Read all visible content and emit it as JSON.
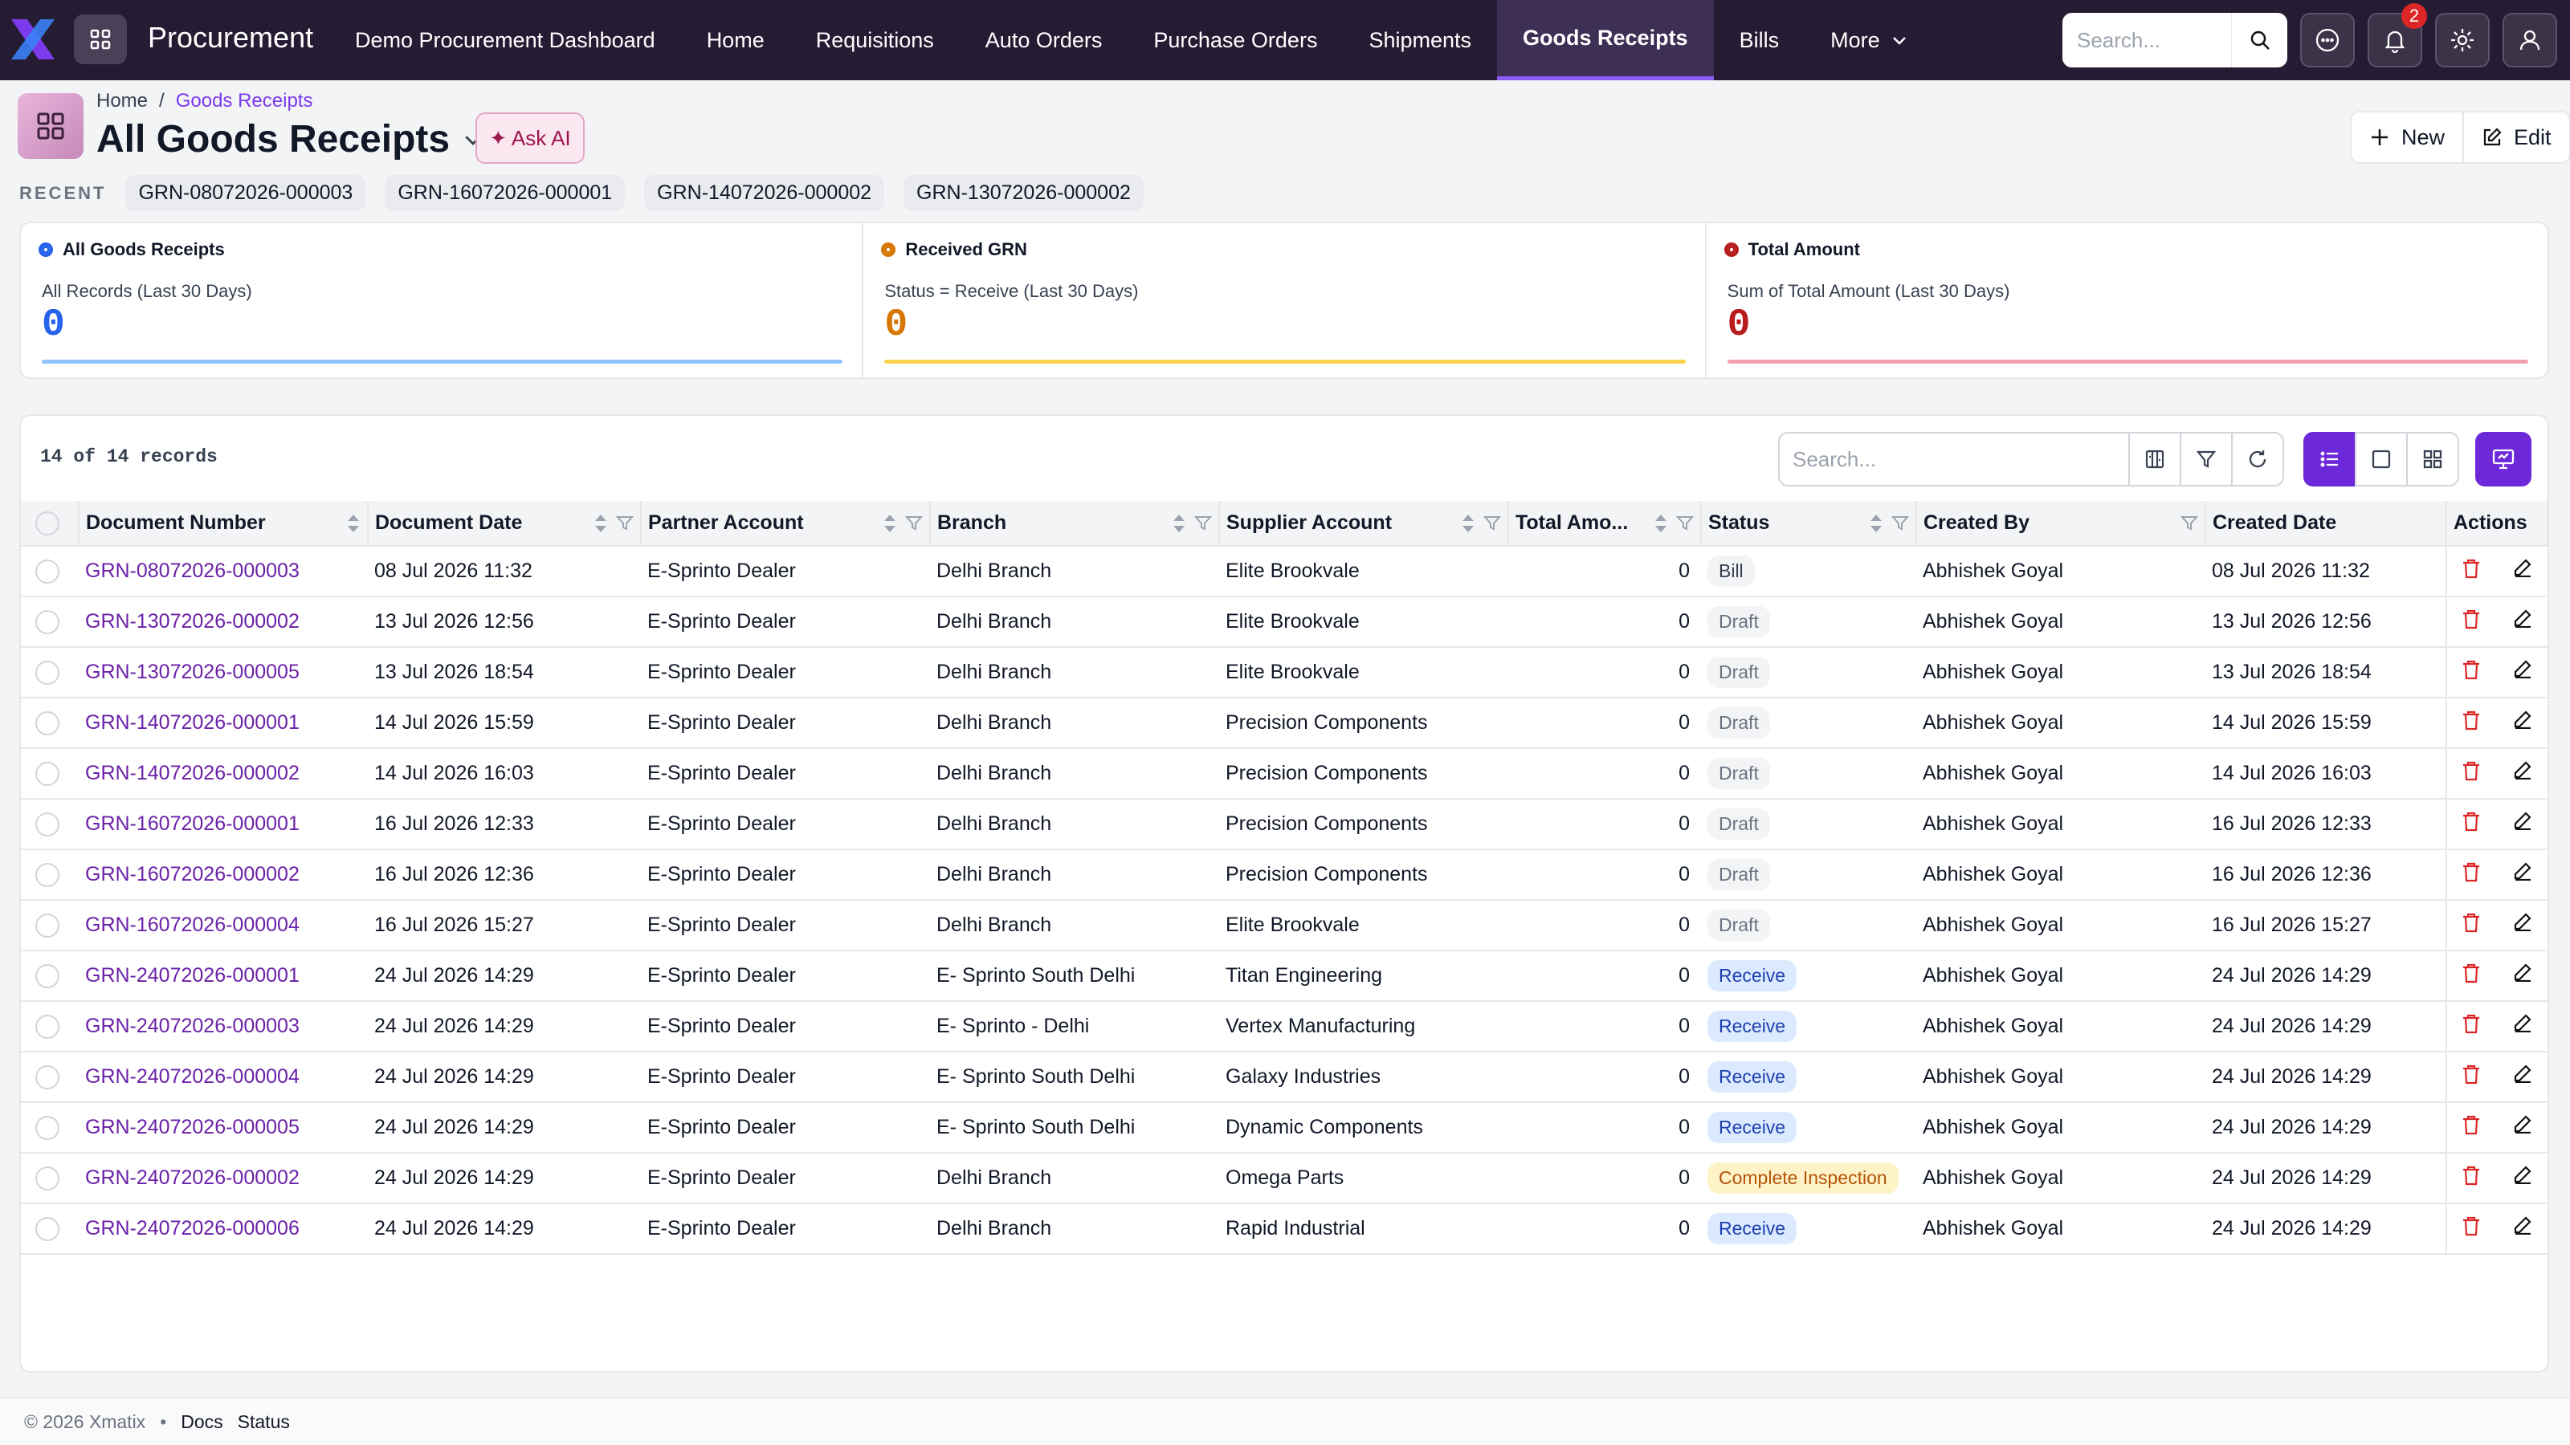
{
  "app": {
    "title": "Procurement"
  },
  "nav": {
    "items": [
      "Demo Procurement Dashboard",
      "Home",
      "Requisitions",
      "Auto Orders",
      "Purchase Orders",
      "Shipments",
      "Goods Receipts",
      "Bills"
    ],
    "more": "More",
    "active": "Goods Receipts"
  },
  "top": {
    "search_placeholder": "Search...",
    "notifications_count": "2"
  },
  "breadcrumb": {
    "home": "Home",
    "sep": "/",
    "current": "Goods Receipts"
  },
  "page": {
    "title": "All Goods Receipts",
    "ask_ai": "✦ Ask AI",
    "new_label": "New",
    "edit_label": "Edit"
  },
  "recent": {
    "label": "RECENT",
    "items": [
      "GRN-08072026-000003",
      "GRN-16072026-000001",
      "GRN-14072026-000002",
      "GRN-13072026-000002"
    ]
  },
  "stats": [
    {
      "title": "All Goods Receipts",
      "subtitle": "All Records (Last 30 Days)",
      "value": "0",
      "color": "#2563eb",
      "bar": "#93c5fd"
    },
    {
      "title": "Received GRN",
      "subtitle": "Status = Receive (Last 30 Days)",
      "value": "0",
      "color": "#d97706",
      "bar": "#fcd34d"
    },
    {
      "title": "Total Amount",
      "subtitle": "Sum of Total Amount (Last 30 Days)",
      "value": "0",
      "color": "#b91c1c",
      "bar": "#f0a3ad"
    }
  ],
  "table": {
    "records_label": "14 of 14 records",
    "search_placeholder": "Search...",
    "columns": [
      "Document Number",
      "Document Date",
      "Partner Account",
      "Branch",
      "Supplier Account",
      "Total Amo...",
      "Status",
      "Created By",
      "Created Date",
      "Actions"
    ],
    "rows": [
      [
        "GRN-08072026-000003",
        "08 Jul 2026 11:32",
        "E-Sprinto Dealer",
        "Delhi Branch",
        "Elite Brookvale",
        "0",
        "Bill",
        "Abhishek Goyal",
        "08 Jul 2026 11:32"
      ],
      [
        "GRN-13072026-000002",
        "13 Jul 2026 12:56",
        "E-Sprinto Dealer",
        "Delhi Branch",
        "Elite Brookvale",
        "0",
        "Draft",
        "Abhishek Goyal",
        "13 Jul 2026 12:56"
      ],
      [
        "GRN-13072026-000005",
        "13 Jul 2026 18:54",
        "E-Sprinto Dealer",
        "Delhi Branch",
        "Elite Brookvale",
        "0",
        "Draft",
        "Abhishek Goyal",
        "13 Jul 2026 18:54"
      ],
      [
        "GRN-14072026-000001",
        "14 Jul 2026 15:59",
        "E-Sprinto Dealer",
        "Delhi Branch",
        "Precision Components",
        "0",
        "Draft",
        "Abhishek Goyal",
        "14 Jul 2026 15:59"
      ],
      [
        "GRN-14072026-000002",
        "14 Jul 2026 16:03",
        "E-Sprinto Dealer",
        "Delhi Branch",
        "Precision Components",
        "0",
        "Draft",
        "Abhishek Goyal",
        "14 Jul 2026 16:03"
      ],
      [
        "GRN-16072026-000001",
        "16 Jul 2026 12:33",
        "E-Sprinto Dealer",
        "Delhi Branch",
        "Precision Components",
        "0",
        "Draft",
        "Abhishek Goyal",
        "16 Jul 2026 12:33"
      ],
      [
        "GRN-16072026-000002",
        "16 Jul 2026 12:36",
        "E-Sprinto Dealer",
        "Delhi Branch",
        "Precision Components",
        "0",
        "Draft",
        "Abhishek Goyal",
        "16 Jul 2026 12:36"
      ],
      [
        "GRN-16072026-000004",
        "16 Jul 2026 15:27",
        "E-Sprinto Dealer",
        "Delhi Branch",
        "Elite Brookvale",
        "0",
        "Draft",
        "Abhishek Goyal",
        "16 Jul 2026 15:27"
      ],
      [
        "GRN-24072026-000001",
        "24 Jul 2026 14:29",
        "E-Sprinto Dealer",
        "E- Sprinto South Delhi",
        "Titan Engineering",
        "0",
        "Receive",
        "Abhishek Goyal",
        "24 Jul 2026 14:29"
      ],
      [
        "GRN-24072026-000003",
        "24 Jul 2026 14:29",
        "E-Sprinto Dealer",
        "E- Sprinto - Delhi",
        "Vertex Manufacturing",
        "0",
        "Receive",
        "Abhishek Goyal",
        "24 Jul 2026 14:29"
      ],
      [
        "GRN-24072026-000004",
        "24 Jul 2026 14:29",
        "E-Sprinto Dealer",
        "E- Sprinto South Delhi",
        "Galaxy Industries",
        "0",
        "Receive",
        "Abhishek Goyal",
        "24 Jul 2026 14:29"
      ],
      [
        "GRN-24072026-000005",
        "24 Jul 2026 14:29",
        "E-Sprinto Dealer",
        "E- Sprinto South Delhi",
        "Dynamic Components",
        "0",
        "Receive",
        "Abhishek Goyal",
        "24 Jul 2026 14:29"
      ],
      [
        "GRN-24072026-000002",
        "24 Jul 2026 14:29",
        "E-Sprinto Dealer",
        "Delhi Branch",
        "Omega Parts",
        "0",
        "Complete Inspection",
        "Abhishek Goyal",
        "24 Jul 2026 14:29"
      ],
      [
        "GRN-24072026-000006",
        "24 Jul 2026 14:29",
        "E-Sprinto Dealer",
        "Delhi Branch",
        "Rapid Industrial",
        "0",
        "Receive",
        "Abhishek Goyal",
        "24 Jul 2026 14:29"
      ]
    ]
  },
  "footer": {
    "copyright": "© 2026 Xmatix",
    "dot": "•",
    "docs": "Docs",
    "status": "Status"
  }
}
